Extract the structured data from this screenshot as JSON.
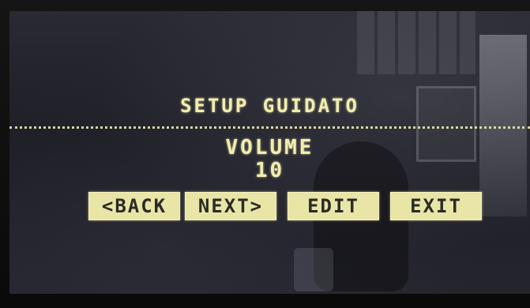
{
  "screen": {
    "title": "SETUP GUIDATO",
    "setting_label": "VOLUME",
    "setting_value": "10"
  },
  "buttons": {
    "back": "<BACK",
    "next": "NEXT>",
    "edit": "EDIT",
    "exit": "EXIT"
  },
  "colors": {
    "lcd_text": "#f2eeb0",
    "button_fill": "#e9e5a6",
    "screen_bg": "#23232b"
  }
}
